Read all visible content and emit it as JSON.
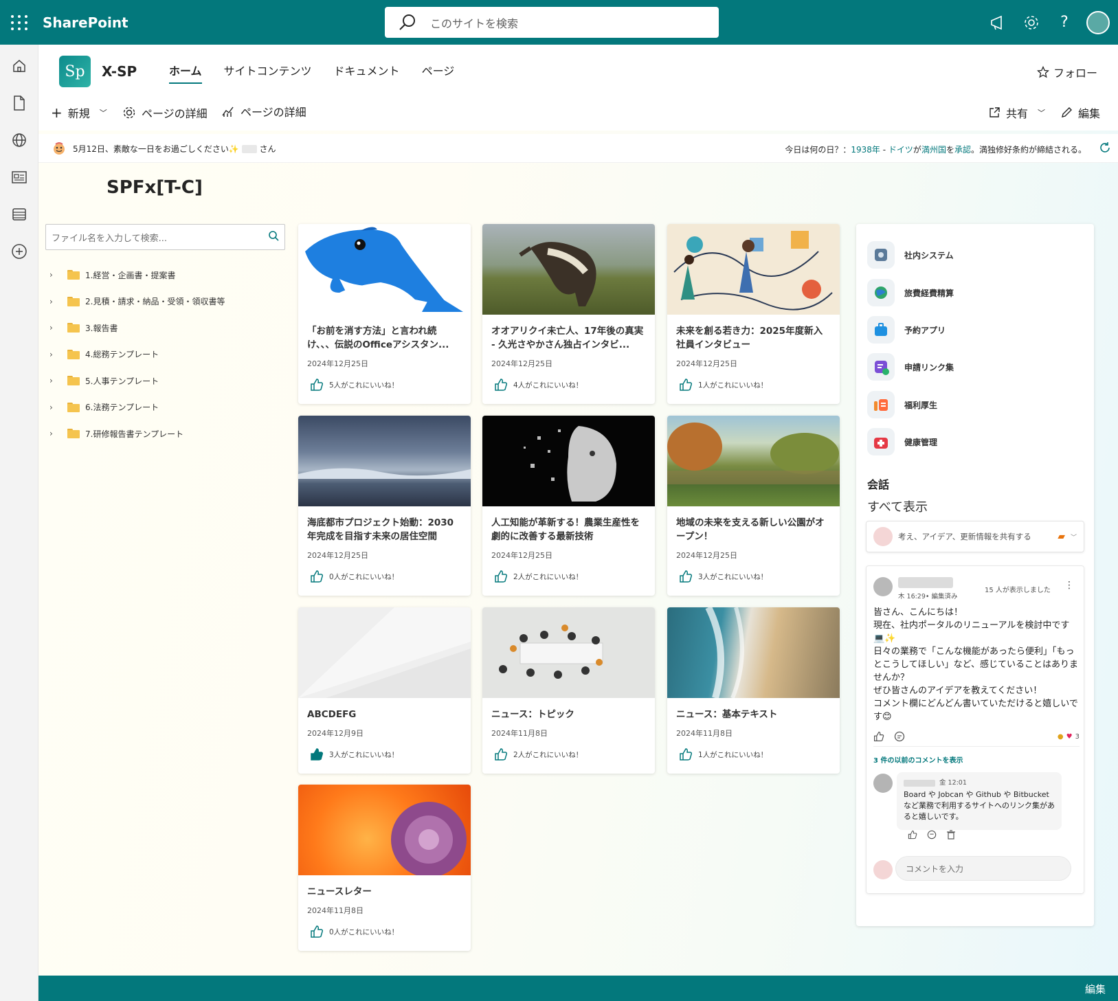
{
  "suite": {
    "brand": "SharePoint",
    "search_placeholder": "このサイトを検索"
  },
  "site": {
    "logo_text": "Sp",
    "name": "X-SP",
    "nav": [
      "ホーム",
      "サイトコンテンツ",
      "ドキュメント",
      "ページ"
    ],
    "follow": "フォロー"
  },
  "commands": {
    "new": "新規",
    "page_details_1": "ページの詳細",
    "page_details_2": "ページの詳細",
    "share": "共有",
    "edit": "編集"
  },
  "greeting": {
    "text_before": "5月12日、素敵な一日をお過ごしください✨",
    "text_after": "さん"
  },
  "today": {
    "prefix": "今日は何の日？：",
    "year": "1938年",
    "sep": " - ",
    "country": "ドイツ",
    "ga": "が",
    "place": "満州国",
    "wo": "を",
    "act": "承認",
    "suffix": "。満独修好条約が締結される。"
  },
  "page_title": "SPFx[T-C]",
  "tree": {
    "search_placeholder": "ファイル名を入力して検索...",
    "items": [
      "1.経営・企画書・提案書",
      "2.見積・請求・納品・受領・領収書等",
      "3.報告書",
      "4.総務テンプレート",
      "5.人事テンプレート",
      "6.法務テンプレート",
      "7.研修報告書テンプレート"
    ]
  },
  "news": [
    {
      "title": "「お前を消す方法」と言われ続け、、、伝説のOfficeアシスタン...",
      "date": "2024年12月25日",
      "likes": "5人がこれにいいね！"
    },
    {
      "title": "オオアリクイ未亡人、17年後の真実 - 久光さやかさん独占インタビ...",
      "date": "2024年12月25日",
      "likes": "4人がこれにいいね！"
    },
    {
      "title": "未来を創る若き力：2025年度新入社員インタビュー",
      "date": "2024年12月25日",
      "likes": "1人がこれにいいね！"
    },
    {
      "title": "海底都市プロジェクト始動：2030年完成を目指す未来の居住空間",
      "date": "2024年12月25日",
      "likes": "0人がこれにいいね！"
    },
    {
      "title": "人工知能が革新する！農業生産性を劇的に改善する最新技術",
      "date": "2024年12月25日",
      "likes": "2人がこれにいいね！"
    },
    {
      "title": "地域の未来を支える新しい公園がオープン！",
      "date": "2024年12月25日",
      "likes": "3人がこれにいいね！"
    },
    {
      "title": "ABCDEFG",
      "date": "2024年12月9日",
      "likes": "3人がこれにいいね！"
    },
    {
      "title": "ニュース：トピック",
      "date": "2024年11月8日",
      "likes": "2人がこれにいいね！"
    },
    {
      "title": "ニュース：基本テキスト",
      "date": "2024年11月8日",
      "likes": "1人がこれにいいね！"
    },
    {
      "title": "ニュースレター",
      "date": "2024年11月8日",
      "likes": "0人がこれにいいね！"
    }
  ],
  "quicklinks": [
    "社内システム",
    "旅費経費精算",
    "予約アプリ",
    "申請リンク集",
    "福利厚生",
    "健康管理"
  ],
  "conversation": {
    "title": "会話",
    "see_all": "すべて表示",
    "share_placeholder": "考え、アイデア、更新情報を共有する",
    "post": {
      "meta": "木 16:29• 編集済み",
      "views": "15 人が表示しました",
      "body": "皆さん、こんにちは！\n現在、社内ポータルのリニューアルを検討中です 💻✨\n日々の業務で「こんな機能があったら便利」「もっとこうしてほしい」など、感じていることはありませんか？\nぜひ皆さんのアイデアを教えてください！\nコメント欄にどんどん書いていただけると嬉しいです😊",
      "reaction_count": "3",
      "previous_comments": "3 件の以前のコメントを表示",
      "comment_time": "金 12:01",
      "comment_text": "Board や Jobcan や Github や Bitbucket など業務で利用するサイトへのリンク集があると嬉しいです。"
    },
    "comment_placeholder": "コメントを入力"
  },
  "footer": {
    "edit": "編集"
  }
}
